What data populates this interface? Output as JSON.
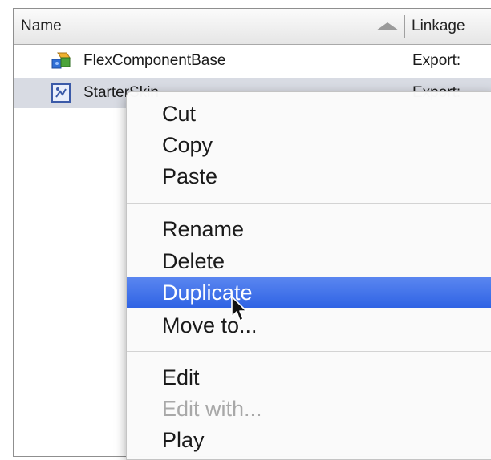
{
  "header": {
    "name_label": "Name",
    "linkage_label": "Linkage"
  },
  "rows": [
    {
      "label": "FlexComponentBase",
      "linkage": "Export:",
      "icon": "component-icon"
    },
    {
      "label": "StarterSkin",
      "linkage": "Export:",
      "icon": "movieclip-icon"
    }
  ],
  "context_menu": {
    "items": [
      {
        "label": "Cut",
        "state": "enabled"
      },
      {
        "label": "Copy",
        "state": "enabled"
      },
      {
        "label": "Paste",
        "state": "enabled"
      },
      {
        "label": "Rename",
        "state": "enabled"
      },
      {
        "label": "Delete",
        "state": "enabled"
      },
      {
        "label": "Duplicate",
        "state": "highlighted"
      },
      {
        "label": "Move to...",
        "state": "enabled"
      },
      {
        "label": "Edit",
        "state": "enabled"
      },
      {
        "label": "Edit with...",
        "state": "disabled"
      },
      {
        "label": "Play",
        "state": "enabled"
      }
    ]
  },
  "colors": {
    "highlight": "#3a6ee8",
    "selected_row": "#d8dbe3",
    "disabled_text": "#a8a8a8"
  }
}
